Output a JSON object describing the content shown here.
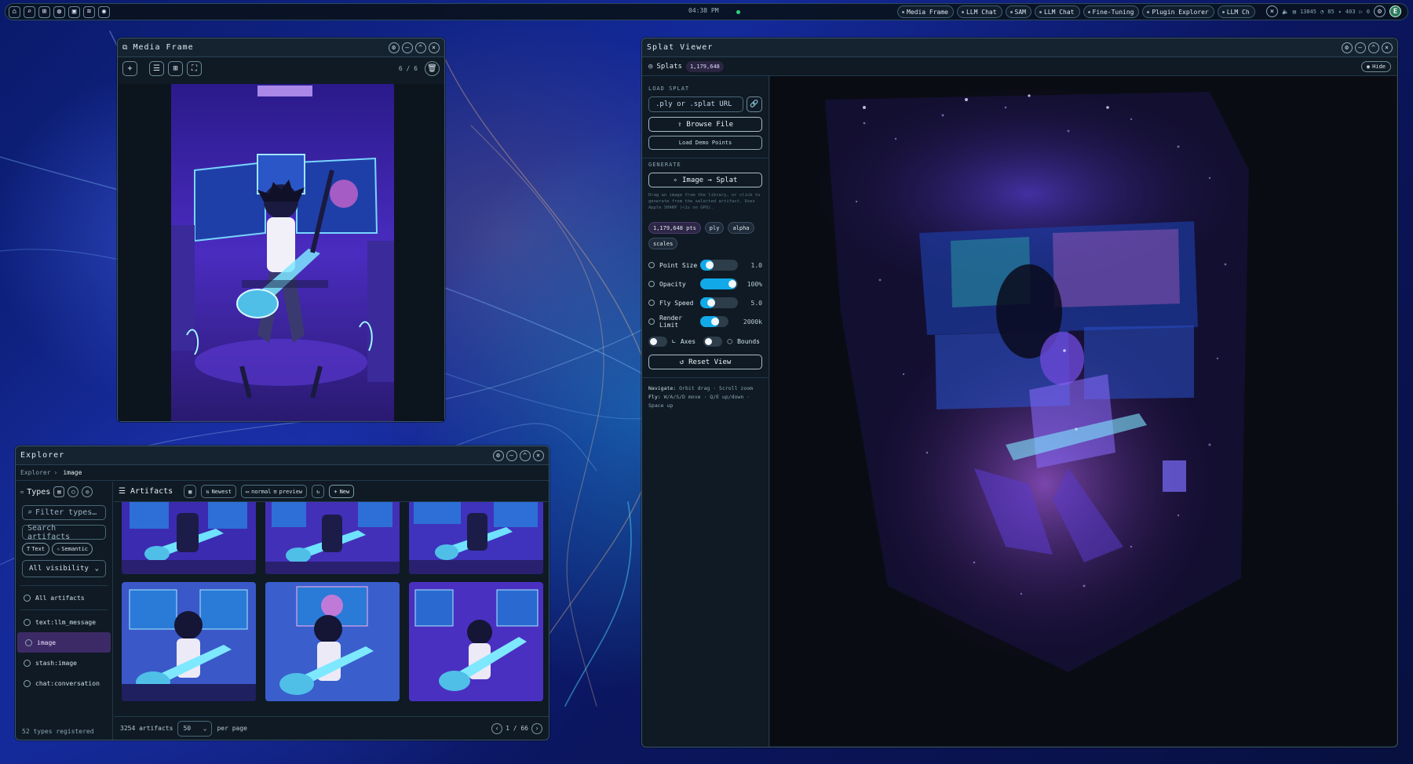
{
  "topbar": {
    "time": "04:38 PM",
    "tabs": [
      "Media Frame",
      "LLM Chat",
      "SAM",
      "LLM Chat",
      "Fine-Tuning",
      "Plugin Explorer",
      "LLM Ch"
    ],
    "stats": [
      "13845",
      "85",
      "403",
      "0"
    ],
    "avatar_letter": "E"
  },
  "media_frame": {
    "title": "Media Frame",
    "count": "6 / 6"
  },
  "explorer": {
    "title": "Explorer",
    "breadcrumb_root": "Explorer",
    "breadcrumb_current": "image",
    "types_label": "Types",
    "filter_placeholder": "Filter types…",
    "search_placeholder": "Search artifacts",
    "pill_text": "Text",
    "pill_semantic": "Semantic",
    "visibility": "All visibility",
    "types": [
      "All artifacts",
      "text:llm_message",
      "image",
      "stash:image",
      "chat:conversation"
    ],
    "active_type": "image",
    "footer": "52 types registered",
    "artifacts_label": "Artifacts",
    "sort": "Newest",
    "view_normal": "normal",
    "view_preview": "preview",
    "new_label": "New",
    "artifact_count": "3254 artifacts",
    "per_page_value": "50",
    "per_page_label": "per page",
    "page": "1 / 66"
  },
  "splat": {
    "title": "Splat Viewer",
    "splats_label": "Splats",
    "splats_count": "1,179,648",
    "hide_label": "Hide",
    "load_label": "LOAD SPLAT",
    "url_placeholder": ".ply or .splat URL",
    "browse_label": "Browse File",
    "demo_label": "Load Demo Points",
    "generate_label": "GENERATE",
    "image_splat_label": "Image → Splat",
    "generate_note": "Drag an image from the library, or click to generate from the selected artifact. Uses Apple SHARP (<1s on GPU).",
    "tags": [
      "1,179,648 pts",
      "ply",
      "alpha",
      "scales"
    ],
    "sliders": [
      {
        "label": "Point Size",
        "value": "1.0",
        "level": 0.15
      },
      {
        "label": "Opacity",
        "value": "100%",
        "level": 1.0
      },
      {
        "label": "Fly Speed",
        "value": "5.0",
        "level": 0.2
      },
      {
        "label": "Render Limit",
        "value": "2000k",
        "level": 0.5
      }
    ],
    "axes_label": "Axes",
    "bounds_label": "Bounds",
    "reset_label": "Reset View",
    "nav_label": "Navigate:",
    "nav_text": "Orbit drag · Scroll zoom",
    "fly_label": "Fly:",
    "fly_text": "W/A/S/D move · Q/E up/down · Space up"
  }
}
